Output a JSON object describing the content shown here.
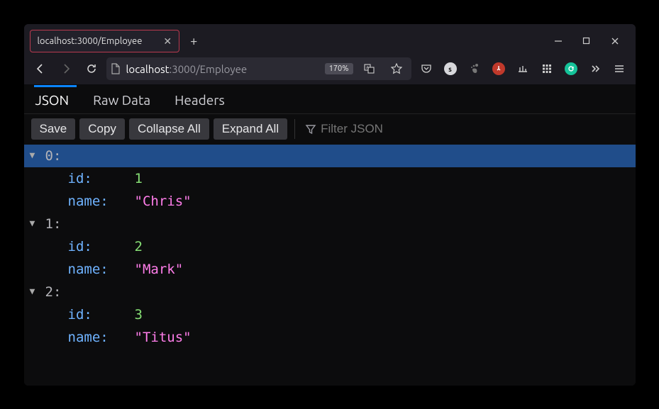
{
  "tab": {
    "title": "localhost:3000/Employee"
  },
  "url": {
    "host": "localhost",
    "rest": ":3000/Employee",
    "zoom": "170%"
  },
  "viewtabs": {
    "json": "JSON",
    "raw": "Raw Data",
    "headers": "Headers"
  },
  "toolbar": {
    "save": "Save",
    "copy": "Copy",
    "collapse": "Collapse All",
    "expand": "Expand All",
    "filter_placeholder": "Filter JSON"
  },
  "json": {
    "entries": [
      {
        "index": "0:",
        "fields": [
          {
            "key": "id:",
            "valNum": "1"
          },
          {
            "key": "name:",
            "valStr": "\"Chris\""
          }
        ]
      },
      {
        "index": "1:",
        "fields": [
          {
            "key": "id:",
            "valNum": "2"
          },
          {
            "key": "name:",
            "valStr": "\"Mark\""
          }
        ]
      },
      {
        "index": "2:",
        "fields": [
          {
            "key": "id:",
            "valNum": "3"
          },
          {
            "key": "name:",
            "valStr": "\"Titus\""
          }
        ]
      }
    ]
  }
}
